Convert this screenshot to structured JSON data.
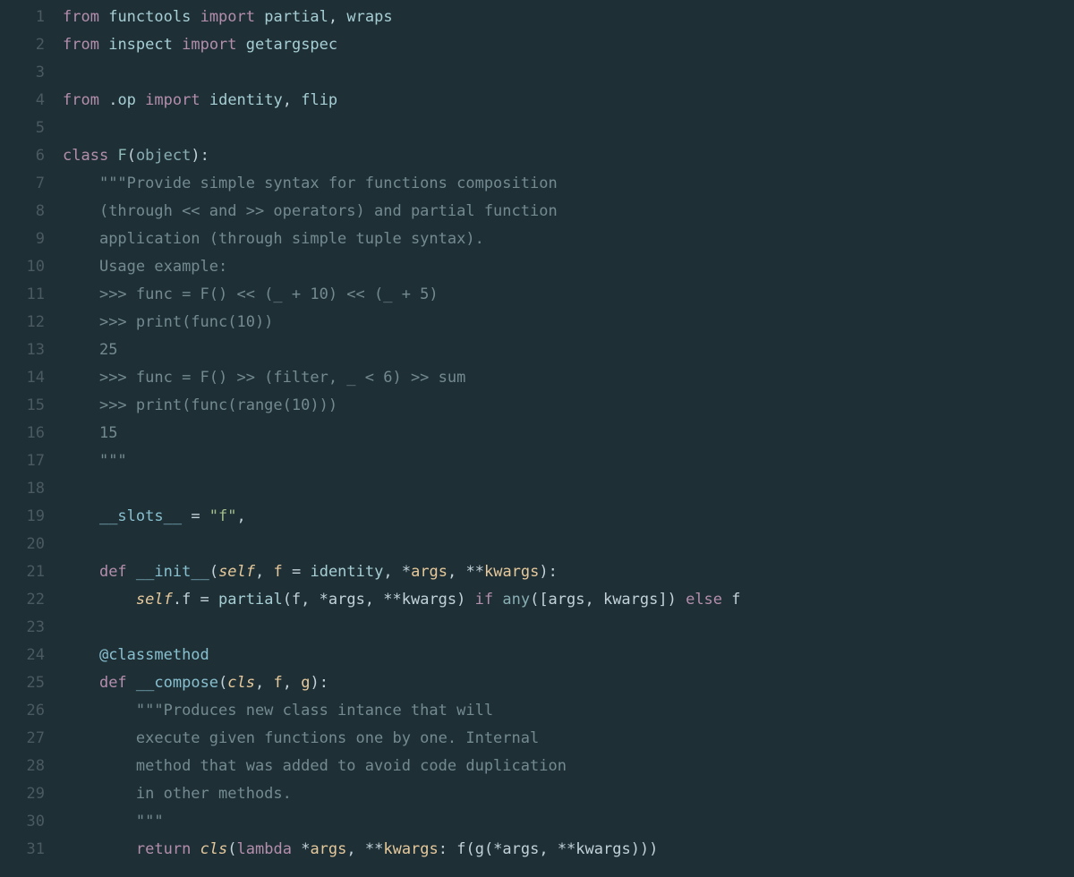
{
  "colors": {
    "bg": "#1e2f35",
    "gutter_fg": "#4a5a60",
    "default_fg": "#c2d2d8",
    "keyword": "#b48ead",
    "func": "#a6cfd5",
    "builtin": "#88aeb4",
    "string_doc": "#738a91",
    "string_lit": "#a3be8c",
    "param": "#e6c99c",
    "dunder": "#88c0d0",
    "indent_guide": "#2c3d43"
  },
  "line_count": 31,
  "line_numbers": [
    "1",
    "2",
    "3",
    "4",
    "5",
    "6",
    "7",
    "8",
    "9",
    "10",
    "11",
    "12",
    "13",
    "14",
    "15",
    "16",
    "17",
    "18",
    "19",
    "20",
    "21",
    "22",
    "23",
    "24",
    "25",
    "26",
    "27",
    "28",
    "29",
    "30",
    "31"
  ],
  "lines": [
    [
      {
        "c": "kw",
        "t": "from"
      },
      {
        "t": " "
      },
      {
        "c": "fn",
        "t": "functools"
      },
      {
        "t": " "
      },
      {
        "c": "kw",
        "t": "import"
      },
      {
        "t": " "
      },
      {
        "c": "fn",
        "t": "partial"
      },
      {
        "t": ", "
      },
      {
        "c": "fn",
        "t": "wraps"
      }
    ],
    [
      {
        "c": "kw",
        "t": "from"
      },
      {
        "t": " "
      },
      {
        "c": "fn",
        "t": "inspect"
      },
      {
        "t": " "
      },
      {
        "c": "kw",
        "t": "import"
      },
      {
        "t": " "
      },
      {
        "c": "fn",
        "t": "getargspec"
      }
    ],
    [],
    [
      {
        "c": "kw",
        "t": "from"
      },
      {
        "t": " ."
      },
      {
        "c": "fn",
        "t": "op"
      },
      {
        "t": " "
      },
      {
        "c": "kw",
        "t": "import"
      },
      {
        "t": " "
      },
      {
        "c": "fn",
        "t": "identity"
      },
      {
        "t": ", "
      },
      {
        "c": "fn",
        "t": "flip"
      }
    ],
    [],
    [
      {
        "c": "kw",
        "t": "class"
      },
      {
        "t": " "
      },
      {
        "c": "cls",
        "t": "F"
      },
      {
        "t": "("
      },
      {
        "c": "builtin",
        "t": "object"
      },
      {
        "t": "):"
      }
    ],
    [
      {
        "t": "    "
      },
      {
        "c": "str",
        "t": "\"\"\"Provide simple syntax for functions composition"
      }
    ],
    [
      {
        "t": "    "
      },
      {
        "c": "str",
        "t": "(through << and >> operators) and partial function"
      }
    ],
    [
      {
        "t": "    "
      },
      {
        "c": "str",
        "t": "application (through simple tuple syntax)."
      }
    ],
    [
      {
        "t": "    "
      },
      {
        "c": "str",
        "t": "Usage example:"
      }
    ],
    [
      {
        "t": "    "
      },
      {
        "c": "str",
        "t": ">>> func = F() << (_ + 10) << (_ + 5)"
      }
    ],
    [
      {
        "t": "    "
      },
      {
        "c": "str",
        "t": ">>> print(func(10))"
      }
    ],
    [
      {
        "t": "    "
      },
      {
        "c": "str",
        "t": "25"
      }
    ],
    [
      {
        "t": "    "
      },
      {
        "c": "str",
        "t": ">>> func = F() >> (filter, _ < 6) >> sum"
      }
    ],
    [
      {
        "t": "    "
      },
      {
        "c": "str",
        "t": ">>> print(func(range(10)))"
      }
    ],
    [
      {
        "t": "    "
      },
      {
        "c": "str",
        "t": "15"
      }
    ],
    [
      {
        "t": "    "
      },
      {
        "c": "str",
        "t": "\"\"\""
      }
    ],
    [],
    [
      {
        "t": "    "
      },
      {
        "c": "dunder",
        "t": "__slots__"
      },
      {
        "t": " = "
      },
      {
        "c": "strlit",
        "t": "\"f\""
      },
      {
        "t": ","
      }
    ],
    [],
    [
      {
        "t": "    "
      },
      {
        "c": "kw",
        "t": "def"
      },
      {
        "t": " "
      },
      {
        "c": "dunder",
        "t": "__init__"
      },
      {
        "t": "("
      },
      {
        "c": "paramit",
        "t": "self"
      },
      {
        "t": ", "
      },
      {
        "c": "param",
        "t": "f"
      },
      {
        "t": " = "
      },
      {
        "c": "fn",
        "t": "identity"
      },
      {
        "t": ", *"
      },
      {
        "c": "param",
        "t": "args"
      },
      {
        "t": ", **"
      },
      {
        "c": "param",
        "t": "kwargs"
      },
      {
        "t": "):"
      }
    ],
    [
      {
        "t": "        "
      },
      {
        "c": "paramit",
        "t": "self"
      },
      {
        "t": ".f = "
      },
      {
        "c": "fn",
        "t": "partial"
      },
      {
        "t": "(f, *args, **kwargs) "
      },
      {
        "c": "kw",
        "t": "if"
      },
      {
        "t": " "
      },
      {
        "c": "builtin",
        "t": "any"
      },
      {
        "t": "([args, kwargs]) "
      },
      {
        "c": "kw",
        "t": "else"
      },
      {
        "t": " f"
      }
    ],
    [],
    [
      {
        "t": "    "
      },
      {
        "c": "dec",
        "t": "@classmethod"
      }
    ],
    [
      {
        "t": "    "
      },
      {
        "c": "kw",
        "t": "def"
      },
      {
        "t": " "
      },
      {
        "c": "dunder",
        "t": "__compose"
      },
      {
        "t": "("
      },
      {
        "c": "paramit",
        "t": "cls"
      },
      {
        "t": ", "
      },
      {
        "c": "param",
        "t": "f"
      },
      {
        "t": ", "
      },
      {
        "c": "param",
        "t": "g"
      },
      {
        "t": "):"
      }
    ],
    [
      {
        "t": "        "
      },
      {
        "c": "str",
        "t": "\"\"\"Produces new class intance that will"
      }
    ],
    [
      {
        "t": "        "
      },
      {
        "c": "str",
        "t": "execute given functions one by one. Internal"
      }
    ],
    [
      {
        "t": "        "
      },
      {
        "c": "str",
        "t": "method that was added to avoid code duplication"
      }
    ],
    [
      {
        "t": "        "
      },
      {
        "c": "str",
        "t": "in other methods."
      }
    ],
    [
      {
        "t": "        "
      },
      {
        "c": "str",
        "t": "\"\"\""
      }
    ],
    [
      {
        "t": "        "
      },
      {
        "c": "kw",
        "t": "return"
      },
      {
        "t": " "
      },
      {
        "c": "paramit",
        "t": "cls"
      },
      {
        "t": "("
      },
      {
        "c": "kw",
        "t": "lambda"
      },
      {
        "t": " *"
      },
      {
        "c": "param",
        "t": "args"
      },
      {
        "t": ", **"
      },
      {
        "c": "param",
        "t": "kwargs"
      },
      {
        "t": ": f(g(*args, **kwargs)))"
      }
    ]
  ]
}
